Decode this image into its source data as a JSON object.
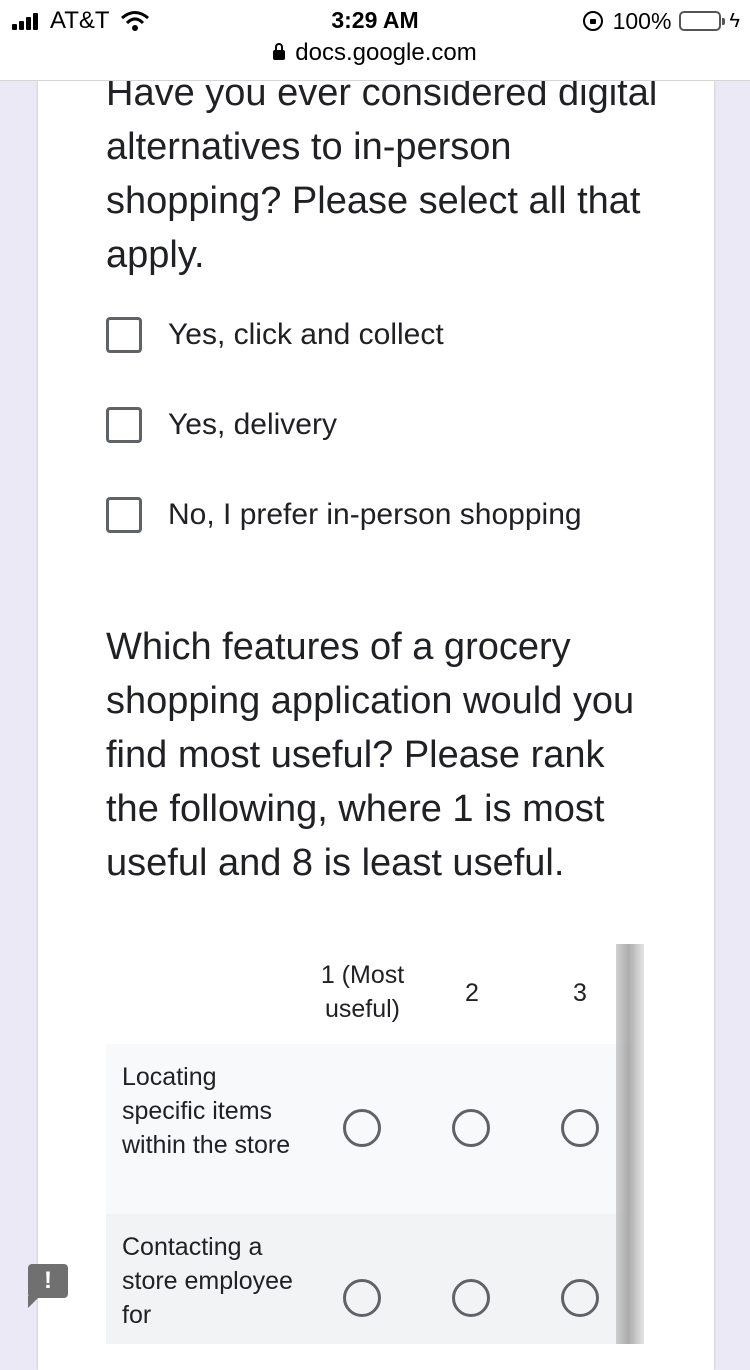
{
  "status_bar": {
    "carrier": "AT&T",
    "time": "3:29 AM",
    "url": "docs.google.com",
    "battery_percent": "100%",
    "battery_level": 1.0
  },
  "form": {
    "question1": {
      "text": "Have you ever considered digital alternatives to in-person shopping? Please select all that apply.",
      "options": [
        "Yes, click and collect",
        "Yes, delivery",
        "No, I prefer in-person shopping"
      ]
    },
    "question2": {
      "text": "Which features of a grocery shopping application would you find most useful? Please rank the following, where 1 is most useful and 8 is least useful.",
      "columns": [
        "1 (Most useful)",
        "2",
        "3"
      ],
      "rows": [
        "Locating specific items within the store",
        "Contacting a store employee for"
      ]
    }
  },
  "feedback_button": {
    "label": "!"
  },
  "colors": {
    "background": "#ece9f6",
    "checkbox_border": "#5f6368",
    "battery": "#65d46e"
  }
}
